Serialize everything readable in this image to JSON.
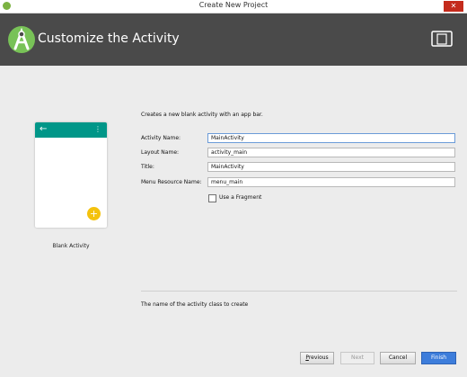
{
  "window": {
    "title": "Create New Project",
    "close_glyph": "✕"
  },
  "header": {
    "title": "Customize the Activity",
    "logo_icon": "android-studio-logo",
    "device_icon": "device-icon"
  },
  "preview": {
    "label": "Blank Activity",
    "back_glyph": "←",
    "menu_glyph": "⋮",
    "fab_glyph": "+",
    "appbar_color": "#009688",
    "fab_color": "#f4c20d"
  },
  "description": "Creates a new blank activity with an app bar.",
  "form": {
    "activity_name": {
      "label": "Activity Name:",
      "value": "MainActivity"
    },
    "layout_name": {
      "label": "Layout Name:",
      "value": "activity_main"
    },
    "title": {
      "label": "Title:",
      "value": "MainActivity"
    },
    "menu_resource_name": {
      "label": "Menu Resource Name:",
      "value": "menu_main"
    },
    "use_fragment": {
      "label": "Use a Fragment",
      "checked": false
    }
  },
  "hint": "The name of the activity class to create",
  "buttons": {
    "previous": "Previous",
    "next": "Next",
    "cancel": "Cancel",
    "finish": "Finish"
  }
}
